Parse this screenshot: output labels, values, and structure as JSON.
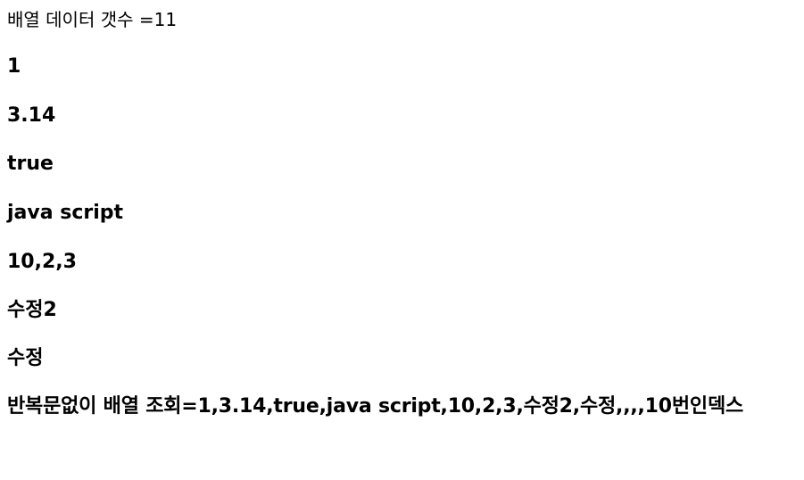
{
  "count_line": "배열 데이터 갯수 =11",
  "items": [
    "1",
    "3.14",
    "true",
    "java script",
    "10,2,3",
    "수정2",
    "수정"
  ],
  "summary_line": "반복문없이 배열 조회=1,3.14,true,java script,10,2,3,수정2,수정,,,,10번인덱스"
}
